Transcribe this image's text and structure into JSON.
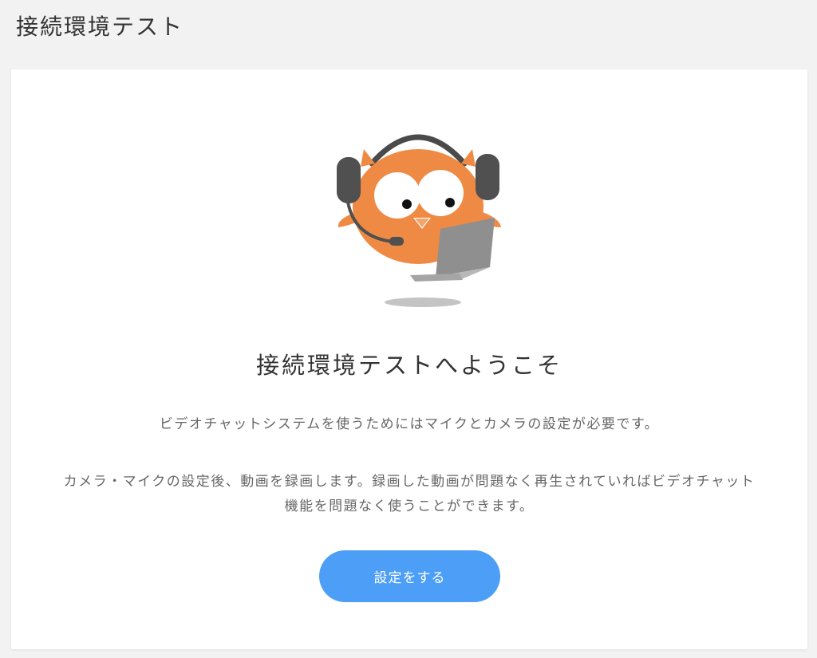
{
  "page": {
    "title": "接続環境テスト"
  },
  "welcome": {
    "heading": "接続環境テストへようこそ",
    "description_1": "ビデオチャットシステムを使うためにはマイクとカメラの設定が必要です。",
    "description_2": "カメラ・マイクの設定後、動画を録画します。録画した動画が問題なく再生されていればビデオチャット機能を問題なく使うことができます。",
    "button_label": "設定をする"
  },
  "mascot": {
    "icon": "owl-with-headset-and-laptop-icon"
  },
  "colors": {
    "background": "#f2f2f2",
    "card": "#ffffff",
    "button": "#4d9ef6",
    "mascot_orange": "#f08a45",
    "headset_gray": "#555555"
  }
}
